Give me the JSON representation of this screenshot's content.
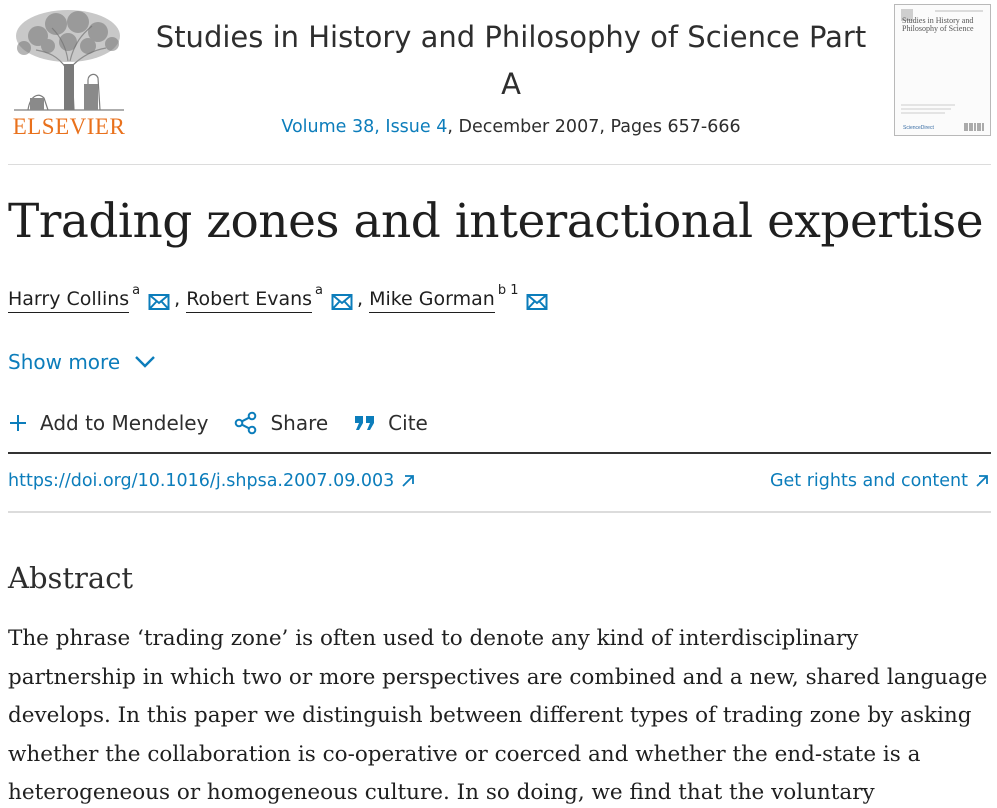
{
  "header": {
    "publisher_name": "ELSEVIER",
    "journal_title_line1": "Studies in History and Philosophy of Science Part",
    "journal_title_line2": "A",
    "issue_link": "Volume 38, Issue 4",
    "issue_rest": ", December 2007, Pages 657-666",
    "cover_title": "Studies in History and Philosophy of Science"
  },
  "article": {
    "title": "Trading zones and interactional expertise",
    "authors": [
      {
        "name": "Harry Collins",
        "affiliation": "a"
      },
      {
        "name": "Robert Evans",
        "affiliation": "a"
      },
      {
        "name": "Mike Gorman",
        "affiliation": "b 1"
      }
    ],
    "show_more": "Show more"
  },
  "toolbar": {
    "mendeley": "Add to Mendeley",
    "share": "Share",
    "cite": "Cite"
  },
  "links": {
    "doi": "https://doi.org/10.1016/j.shpsa.2007.09.003",
    "rights": "Get rights and content"
  },
  "abstract": {
    "heading": "Abstract",
    "lines": [
      "The phrase ‘trading zone’ is often used to denote any kind of interdisciplinary",
      "partnership in which two or more perspectives are combined and a new, shared language",
      "develops. In this paper we distinguish between different types of trading zone by asking",
      "whether the collaboration is co-operative or coerced and whether the end-state is a",
      "heterogeneous or homogeneous culture. In so doing, we find that the voluntary"
    ]
  },
  "colors": {
    "link": "#0c7dbb",
    "publisher_orange": "#e9711c",
    "text": "#1f1f1f"
  },
  "icons": [
    "elsevier-tree-logo",
    "mail-icon",
    "chevron-down-icon",
    "plus-icon",
    "share-icon",
    "quote-icon",
    "external-arrow-icon"
  ]
}
